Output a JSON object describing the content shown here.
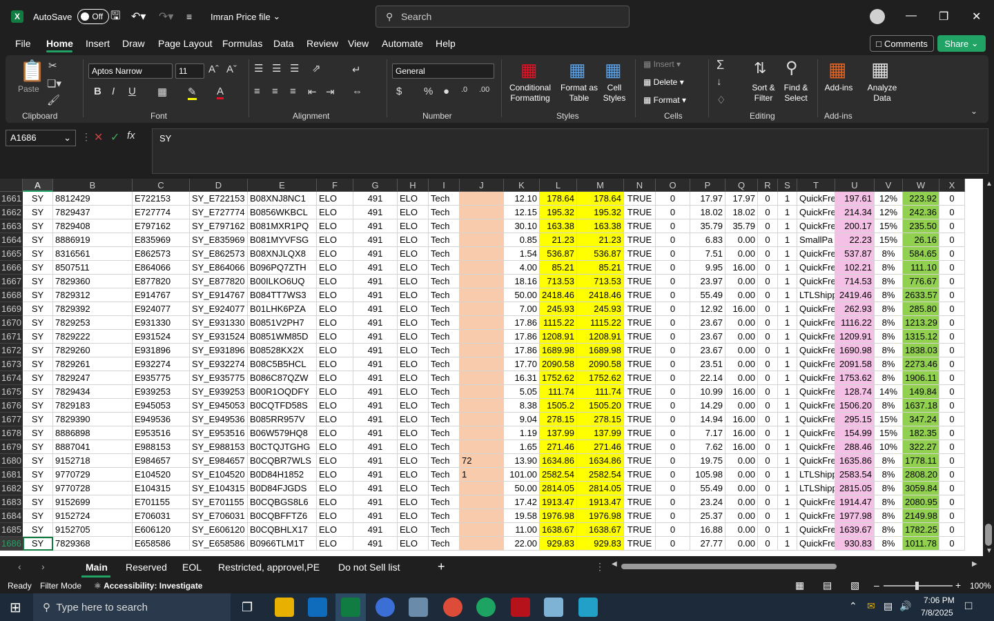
{
  "title": {
    "autosave_label": "AutoSave",
    "autosave_state": "Off",
    "file_name": "Imran Price file",
    "search_placeholder": "Search"
  },
  "menu": [
    "File",
    "Home",
    "Insert",
    "Draw",
    "Page Layout",
    "Formulas",
    "Data",
    "Review",
    "View",
    "Automate",
    "Help"
  ],
  "buttons": {
    "comments": "Comments",
    "share": "Share"
  },
  "ribbon": {
    "clipboard": {
      "label": "Clipboard",
      "paste": "Paste"
    },
    "font": {
      "label": "Font",
      "name": "Aptos Narrow",
      "size": "11"
    },
    "alignment": {
      "label": "Alignment"
    },
    "number": {
      "label": "Number",
      "format": "General"
    },
    "styles": {
      "label": "Styles",
      "conditional": "Conditional Formatting",
      "format_table": "Format as Table",
      "cell_styles": "Cell Styles"
    },
    "cells": {
      "label": "Cells",
      "insert": "Insert",
      "delete": "Delete",
      "format": "Format"
    },
    "editing": {
      "label": "Editing",
      "sort": "Sort & Filter",
      "find": "Find & Select"
    },
    "addins": {
      "label": "Add-ins",
      "addins": "Add-ins",
      "analyze": "Analyze Data"
    }
  },
  "formula_bar": {
    "name_box": "A1686",
    "formula": "SY"
  },
  "columns": [
    "A",
    "B",
    "C",
    "D",
    "E",
    "F",
    "G",
    "H",
    "I",
    "J",
    "K",
    "L",
    "M",
    "N",
    "O",
    "P",
    "Q",
    "R",
    "S",
    "T",
    "U",
    "V",
    "W",
    "X"
  ],
  "rows": [
    [
      "1661",
      "SY",
      "8812429",
      "E722153",
      "SY_E722153",
      "B08XNJ8NC1",
      "ELO",
      "491",
      "ELO",
      "Tech",
      "",
      "12.10",
      "178.64",
      "178.64",
      "TRUE",
      "0",
      "17.97",
      "17.97",
      "0",
      "1",
      "QuickFre",
      "197.61",
      "12%",
      "223.92",
      "0"
    ],
    [
      "1662",
      "SY",
      "7829437",
      "E727774",
      "SY_E727774",
      "B0856WKBCL",
      "ELO",
      "491",
      "ELO",
      "Tech",
      "",
      "12.15",
      "195.32",
      "195.32",
      "TRUE",
      "0",
      "18.02",
      "18.02",
      "0",
      "1",
      "QuickFre",
      "214.34",
      "12%",
      "242.36",
      "0"
    ],
    [
      "1663",
      "SY",
      "7829408",
      "E797162",
      "SY_E797162",
      "B081MXR1PQ",
      "ELO",
      "491",
      "ELO",
      "Tech",
      "",
      "30.10",
      "163.38",
      "163.38",
      "TRUE",
      "0",
      "35.79",
      "35.79",
      "0",
      "1",
      "QuickFre",
      "200.17",
      "15%",
      "235.50",
      "0"
    ],
    [
      "1664",
      "SY",
      "8886919",
      "E835969",
      "SY_E835969",
      "B081MYVFSG",
      "ELO",
      "491",
      "ELO",
      "Tech",
      "",
      "0.85",
      "21.23",
      "21.23",
      "TRUE",
      "0",
      "6.83",
      "0.00",
      "0",
      "1",
      "SmallPa",
      "22.23",
      "15%",
      "26.16",
      "0"
    ],
    [
      "1665",
      "SY",
      "8316561",
      "E862573",
      "SY_E862573",
      "B08XNJLQX8",
      "ELO",
      "491",
      "ELO",
      "Tech",
      "",
      "1.54",
      "536.87",
      "536.87",
      "TRUE",
      "0",
      "7.51",
      "0.00",
      "0",
      "1",
      "QuickFre",
      "537.87",
      "8%",
      "584.65",
      "0"
    ],
    [
      "1666",
      "SY",
      "8507511",
      "E864066",
      "SY_E864066",
      "B096PQ7ZTH",
      "ELO",
      "491",
      "ELO",
      "Tech",
      "",
      "4.00",
      "85.21",
      "85.21",
      "TRUE",
      "0",
      "9.95",
      "16.00",
      "0",
      "1",
      "QuickFre",
      "102.21",
      "8%",
      "111.10",
      "0"
    ],
    [
      "1667",
      "SY",
      "7829360",
      "E877820",
      "SY_E877820",
      "B00ILKO6UQ",
      "ELO",
      "491",
      "ELO",
      "Tech",
      "",
      "18.16",
      "713.53",
      "713.53",
      "TRUE",
      "0",
      "23.97",
      "0.00",
      "0",
      "1",
      "QuickFre",
      "714.53",
      "8%",
      "776.67",
      "0"
    ],
    [
      "1668",
      "SY",
      "7829312",
      "E914767",
      "SY_E914767",
      "B084TT7WS3",
      "ELO",
      "491",
      "ELO",
      "Tech",
      "",
      "50.00",
      "2418.46",
      "2418.46",
      "TRUE",
      "0",
      "55.49",
      "0.00",
      "0",
      "1",
      "LTLShipp",
      "2419.46",
      "8%",
      "2633.57",
      "0"
    ],
    [
      "1669",
      "SY",
      "7829392",
      "E924077",
      "SY_E924077",
      "B01LHK6PZA",
      "ELO",
      "491",
      "ELO",
      "Tech",
      "",
      "7.00",
      "245.93",
      "245.93",
      "TRUE",
      "0",
      "12.92",
      "16.00",
      "0",
      "1",
      "QuickFre",
      "262.93",
      "8%",
      "285.80",
      "0"
    ],
    [
      "1670",
      "SY",
      "7829253",
      "E931330",
      "SY_E931330",
      "B0851V2PH7",
      "ELO",
      "491",
      "ELO",
      "Tech",
      "",
      "17.86",
      "1115.22",
      "1115.22",
      "TRUE",
      "0",
      "23.67",
      "0.00",
      "0",
      "1",
      "QuickFre",
      "1116.22",
      "8%",
      "1213.29",
      "0"
    ],
    [
      "1671",
      "SY",
      "7829222",
      "E931524",
      "SY_E931524",
      "B0851WM85D",
      "ELO",
      "491",
      "ELO",
      "Tech",
      "",
      "17.86",
      "1208.91",
      "1208.91",
      "TRUE",
      "0",
      "23.67",
      "0.00",
      "0",
      "1",
      "QuickFre",
      "1209.91",
      "8%",
      "1315.12",
      "0"
    ],
    [
      "1672",
      "SY",
      "7829260",
      "E931896",
      "SY_E931896",
      "B08528KX2X",
      "ELO",
      "491",
      "ELO",
      "Tech",
      "",
      "17.86",
      "1689.98",
      "1689.98",
      "TRUE",
      "0",
      "23.67",
      "0.00",
      "0",
      "1",
      "QuickFre",
      "1690.98",
      "8%",
      "1838.03",
      "0"
    ],
    [
      "1673",
      "SY",
      "7829261",
      "E932274",
      "SY_E932274",
      "B08C5B5HCL",
      "ELO",
      "491",
      "ELO",
      "Tech",
      "",
      "17.70",
      "2090.58",
      "2090.58",
      "TRUE",
      "0",
      "23.51",
      "0.00",
      "0",
      "1",
      "QuickFre",
      "2091.58",
      "8%",
      "2273.46",
      "0"
    ],
    [
      "1674",
      "SY",
      "7829247",
      "E935775",
      "SY_E935775",
      "B086C87QZW",
      "ELO",
      "491",
      "ELO",
      "Tech",
      "",
      "16.31",
      "1752.62",
      "1752.62",
      "TRUE",
      "0",
      "22.14",
      "0.00",
      "0",
      "1",
      "QuickFre",
      "1753.62",
      "8%",
      "1906.11",
      "0"
    ],
    [
      "1675",
      "SY",
      "7829434",
      "E939253",
      "SY_E939253",
      "B00R1OQDFY",
      "ELO",
      "491",
      "ELO",
      "Tech",
      "",
      "5.05",
      "111.74",
      "111.74",
      "TRUE",
      "0",
      "10.99",
      "16.00",
      "0",
      "1",
      "QuickFre",
      "128.74",
      "14%",
      "149.84",
      "0"
    ],
    [
      "1676",
      "SY",
      "7829183",
      "E945053",
      "SY_E945053",
      "B0CQTFD58S",
      "ELO",
      "491",
      "ELO",
      "Tech",
      "",
      "8.38",
      "1505.2",
      "1505.20",
      "TRUE",
      "0",
      "14.29",
      "0.00",
      "0",
      "1",
      "QuickFre",
      "1506.20",
      "8%",
      "1637.18",
      "0"
    ],
    [
      "1677",
      "SY",
      "7829390",
      "E949536",
      "SY_E949536",
      "B085RR957V",
      "ELO",
      "491",
      "ELO",
      "Tech",
      "",
      "9.04",
      "278.15",
      "278.15",
      "TRUE",
      "0",
      "14.94",
      "16.00",
      "0",
      "1",
      "QuickFre",
      "295.15",
      "15%",
      "347.24",
      "0"
    ],
    [
      "1678",
      "SY",
      "8886898",
      "E953516",
      "SY_E953516",
      "B06W579HQ8",
      "ELO",
      "491",
      "ELO",
      "Tech",
      "",
      "1.19",
      "137.99",
      "137.99",
      "TRUE",
      "0",
      "7.17",
      "16.00",
      "0",
      "1",
      "QuickFre",
      "154.99",
      "15%",
      "182.35",
      "0"
    ],
    [
      "1679",
      "SY",
      "8887041",
      "E988153",
      "SY_E988153",
      "B0CTQJTGHG",
      "ELO",
      "491",
      "ELO",
      "Tech",
      "",
      "1.65",
      "271.46",
      "271.46",
      "TRUE",
      "0",
      "7.62",
      "16.00",
      "0",
      "1",
      "QuickFre",
      "288.46",
      "10%",
      "322.27",
      "0"
    ],
    [
      "1680",
      "SY",
      "9152718",
      "E984657",
      "SY_E984657",
      "B0CQBR7WLS",
      "ELO",
      "491",
      "ELO",
      "Tech",
      "72",
      "13.90",
      "1634.86",
      "1634.86",
      "TRUE",
      "0",
      "19.75",
      "0.00",
      "0",
      "1",
      "QuickFre",
      "1635.86",
      "8%",
      "1778.11",
      "0"
    ],
    [
      "1681",
      "SY",
      "9770729",
      "E104520",
      "SY_E104520",
      "B0D84H1852",
      "ELO",
      "491",
      "ELO",
      "Tech",
      "1",
      "101.00",
      "2582.54",
      "2582.54",
      "TRUE",
      "0",
      "105.98",
      "0.00",
      "0",
      "1",
      "LTLShipp",
      "2583.54",
      "8%",
      "2808.20",
      "0"
    ],
    [
      "1682",
      "SY",
      "9770728",
      "E104315",
      "SY_E104315",
      "B0D84FJGDS",
      "ELO",
      "491",
      "ELO",
      "Tech",
      "",
      "50.00",
      "2814.05",
      "2814.05",
      "TRUE",
      "0",
      "55.49",
      "0.00",
      "0",
      "1",
      "LTLShipp",
      "2815.05",
      "8%",
      "3059.84",
      "0"
    ],
    [
      "1683",
      "SY",
      "9152699",
      "E701155",
      "SY_E701155",
      "B0CQBGS8L6",
      "ELO",
      "491",
      "ELO",
      "Tech",
      "",
      "17.42",
      "1913.47",
      "1913.47",
      "TRUE",
      "0",
      "23.24",
      "0.00",
      "0",
      "1",
      "QuickFre",
      "1914.47",
      "8%",
      "2080.95",
      "0"
    ],
    [
      "1684",
      "SY",
      "9152724",
      "E706031",
      "SY_E706031",
      "B0CQBFFTZ6",
      "ELO",
      "491",
      "ELO",
      "Tech",
      "",
      "19.58",
      "1976.98",
      "1976.98",
      "TRUE",
      "0",
      "25.37",
      "0.00",
      "0",
      "1",
      "QuickFre",
      "1977.98",
      "8%",
      "2149.98",
      "0"
    ],
    [
      "1685",
      "SY",
      "9152705",
      "E606120",
      "SY_E606120",
      "B0CQBHLX17",
      "ELO",
      "491",
      "ELO",
      "Tech",
      "",
      "11.00",
      "1638.67",
      "1638.67",
      "TRUE",
      "0",
      "16.88",
      "0.00",
      "0",
      "1",
      "QuickFre",
      "1639.67",
      "8%",
      "1782.25",
      "0"
    ],
    [
      "1686",
      "SY",
      "7829368",
      "E658586",
      "SY_E658586",
      "B0966TLM1T",
      "ELO",
      "491",
      "ELO",
      "Tech",
      "",
      "22.00",
      "929.83",
      "929.83",
      "TRUE",
      "0",
      "27.77",
      "0.00",
      "0",
      "1",
      "QuickFre",
      "930.83",
      "8%",
      "1011.78",
      "0"
    ]
  ],
  "sheets": [
    "Main",
    "Reserved",
    "EOL",
    "Restricted, approvel,PE",
    "Do not Sell list"
  ],
  "status": {
    "ready": "Ready",
    "filter": "Filter Mode",
    "accessibility": "Accessibility: Investigate",
    "zoom": "100%"
  },
  "taskbar": {
    "search_placeholder": "Type here to search",
    "time": "7:06 PM",
    "date": "7/8/2025"
  },
  "colors": {
    "accent": "#21a366",
    "yellow": "#ffff00",
    "peach": "#f8cbad",
    "pink": "#f4c0e6",
    "green": "#92d050"
  }
}
